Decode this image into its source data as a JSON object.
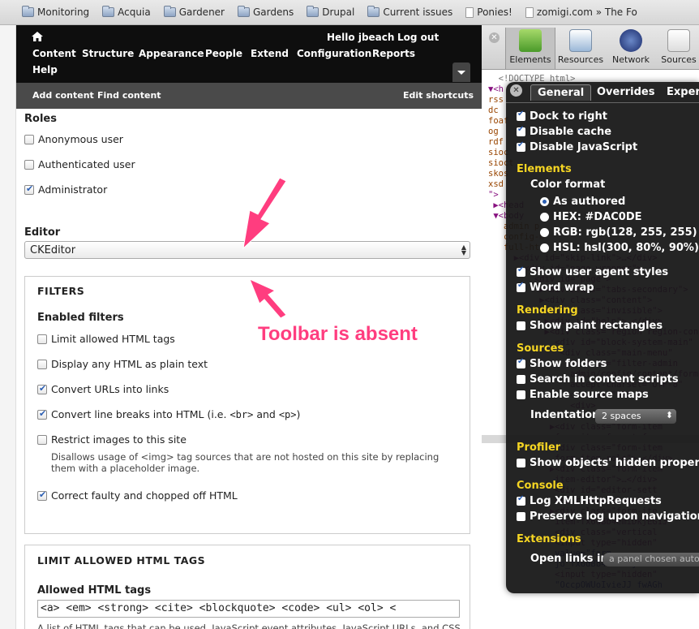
{
  "bookmarks": [
    {
      "label": "Monitoring",
      "icon": "folder-icon"
    },
    {
      "label": "Acquia",
      "icon": "folder-icon"
    },
    {
      "label": "Gardener",
      "icon": "folder-icon"
    },
    {
      "label": "Gardens",
      "icon": "folder-icon"
    },
    {
      "label": "Drupal",
      "icon": "folder-icon"
    },
    {
      "label": "Current issues",
      "icon": "folder-icon"
    },
    {
      "label": "Ponies!",
      "icon": "page-icon"
    },
    {
      "label": "zomigi.com » The Fo",
      "icon": "page-icon"
    }
  ],
  "toolbar": {
    "greeting": "Hello jbeach",
    "logout": "Log out",
    "items": [
      "Content",
      "Structure",
      "Appearance",
      "People",
      "Extend",
      "Configuration",
      "Reports",
      "Help"
    ]
  },
  "shortcuts": {
    "add_content": "Add content",
    "find_content": "Find content",
    "edit_shortcuts": "Edit shortcuts"
  },
  "roles": {
    "title": "Roles",
    "items": [
      {
        "label": "Anonymous user",
        "checked": false
      },
      {
        "label": "Authenticated user",
        "checked": false
      },
      {
        "label": "Administrator",
        "checked": true
      }
    ]
  },
  "editor": {
    "label": "Editor",
    "value": "CKEditor"
  },
  "filters": {
    "title": "FILTERS",
    "subtitle": "Enabled filters",
    "items": [
      {
        "label": "Limit allowed HTML tags",
        "checked": false
      },
      {
        "label": "Display any HTML as plain text",
        "checked": false
      },
      {
        "label": "Convert URLs into links",
        "checked": true
      },
      {
        "label_prefix": "Convert line breaks into HTML (i.e. ",
        "code1": "<br>",
        "mid": " and ",
        "code2": "<p>",
        "suffix": ")",
        "checked": true
      },
      {
        "label": "Restrict images to this site",
        "checked": false,
        "description_1": "Disallows usage of <img> tag sources that are not hosted on this site by replacing",
        "description_2": "them with a placeholder image."
      },
      {
        "label": "Correct faulty and chopped off HTML",
        "checked": true
      }
    ]
  },
  "limit_tags": {
    "title": "LIMIT ALLOWED HTML TAGS",
    "subtitle": "Allowed HTML tags",
    "value": "<a> <em> <strong> <cite> <blockquote> <code> <ul> <ol> <",
    "help": "A list of HTML tags that can be used. JavaScript event attributes, JavaScript URLs, and CSS"
  },
  "annotation": {
    "text": "Toolbar is absent",
    "color": "#ff3d7f"
  },
  "devtools": {
    "tabs": [
      {
        "label": "Elements",
        "icon": "elements-icon"
      },
      {
        "label": "Resources",
        "icon": "resources-icon"
      },
      {
        "label": "Network",
        "icon": "network-icon"
      },
      {
        "label": "Sources",
        "icon": "sources-icon"
      }
    ],
    "active_tab": "Elements"
  },
  "settings": {
    "tabs": [
      "General",
      "Overrides",
      "Exper"
    ],
    "dock_to_right": "Dock to right",
    "disable_cache": "Disable cache",
    "disable_javascript": "Disable JavaScript",
    "elements_title": "Elements",
    "color_format": "Color format",
    "color_options": [
      "As authored",
      "HEX: #DAC0DE",
      "RGB: rgb(128, 255, 255)",
      "HSL: hsl(300, 80%, 90%)"
    ],
    "show_ua_styles": "Show user agent styles",
    "word_wrap": "Word wrap",
    "rendering_title": "Rendering",
    "show_paint": "Show paint rectangles",
    "sources_title": "Sources",
    "show_folders": "Show folders",
    "search_scripts": "Search in content scripts",
    "enable_source_maps": "Enable source maps",
    "indentation_label": "Indentation",
    "indentation_value": "2 spaces",
    "profiler_title": "Profiler",
    "show_hidden_props": "Show objects' hidden properties",
    "console_title": "Console",
    "log_xhr": "Log XMLHttpRequests",
    "preserve_log": "Preserve log upon navigation",
    "extensions_title": "Extensions",
    "open_links_label": "Open links in",
    "open_links_value": "a panel chosen autom",
    "accent": "#f5d523"
  }
}
